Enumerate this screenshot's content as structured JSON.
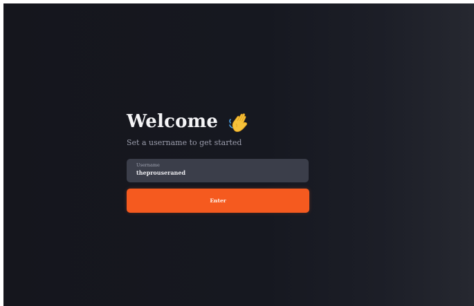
{
  "welcome": {
    "title": "Welcome",
    "icon": "waving-hand-icon",
    "subtitle": "Set a username to get started"
  },
  "username": {
    "label": "Username",
    "value": "theprouseraned"
  },
  "enter_button": {
    "label": "Enter",
    "color": "#f55a1f"
  },
  "colors": {
    "background": "#15161d",
    "field": "#3b3e4a",
    "accent": "#f55a1f"
  }
}
